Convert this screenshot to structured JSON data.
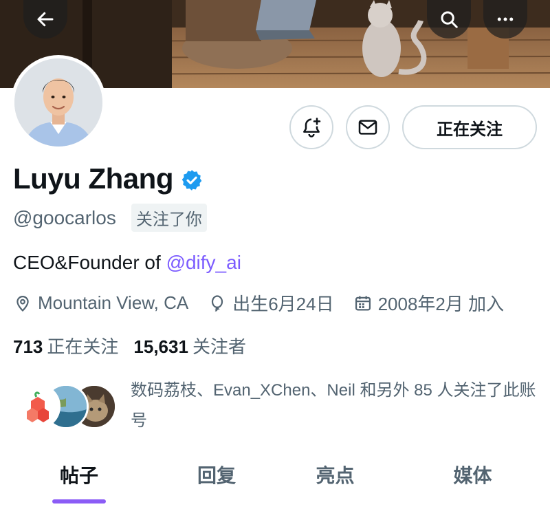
{
  "header": {
    "back_icon": "arrow-left-icon",
    "search_icon": "search-icon",
    "more_icon": "more-horizontal-icon"
  },
  "profile": {
    "name": "Luyu Zhang",
    "verified": true,
    "verified_color": "#1d9bf0",
    "handle": "@goocarlos",
    "follows_you": "关注了你",
    "bio_prefix": "CEO&Founder of ",
    "bio_mention": "@dify_ai",
    "mention_color": "#7c5cff",
    "location": "Mountain View, CA",
    "birthday": "出生6月24日",
    "joined": "2008年2月 加入",
    "following_count": "713",
    "following_label": "正在关注",
    "followers_count": "15,631",
    "followers_label": "关注者",
    "followed_by_text": "数码荔枝、Evan_XChen、Neil 和另外 85 人关注了此账号"
  },
  "actions": {
    "notify_icon": "bell-plus-icon",
    "message_icon": "mail-icon",
    "following_button": "正在关注"
  },
  "tabs": [
    {
      "label": "帖子",
      "active": true
    },
    {
      "label": "回复",
      "active": false
    },
    {
      "label": "亮点",
      "active": false
    },
    {
      "label": "媒体",
      "active": false
    }
  ],
  "colors": {
    "text": "#0f1419",
    "secondary": "#536471",
    "border": "#cfd9de",
    "tab_indicator": "#8b5cf6"
  }
}
